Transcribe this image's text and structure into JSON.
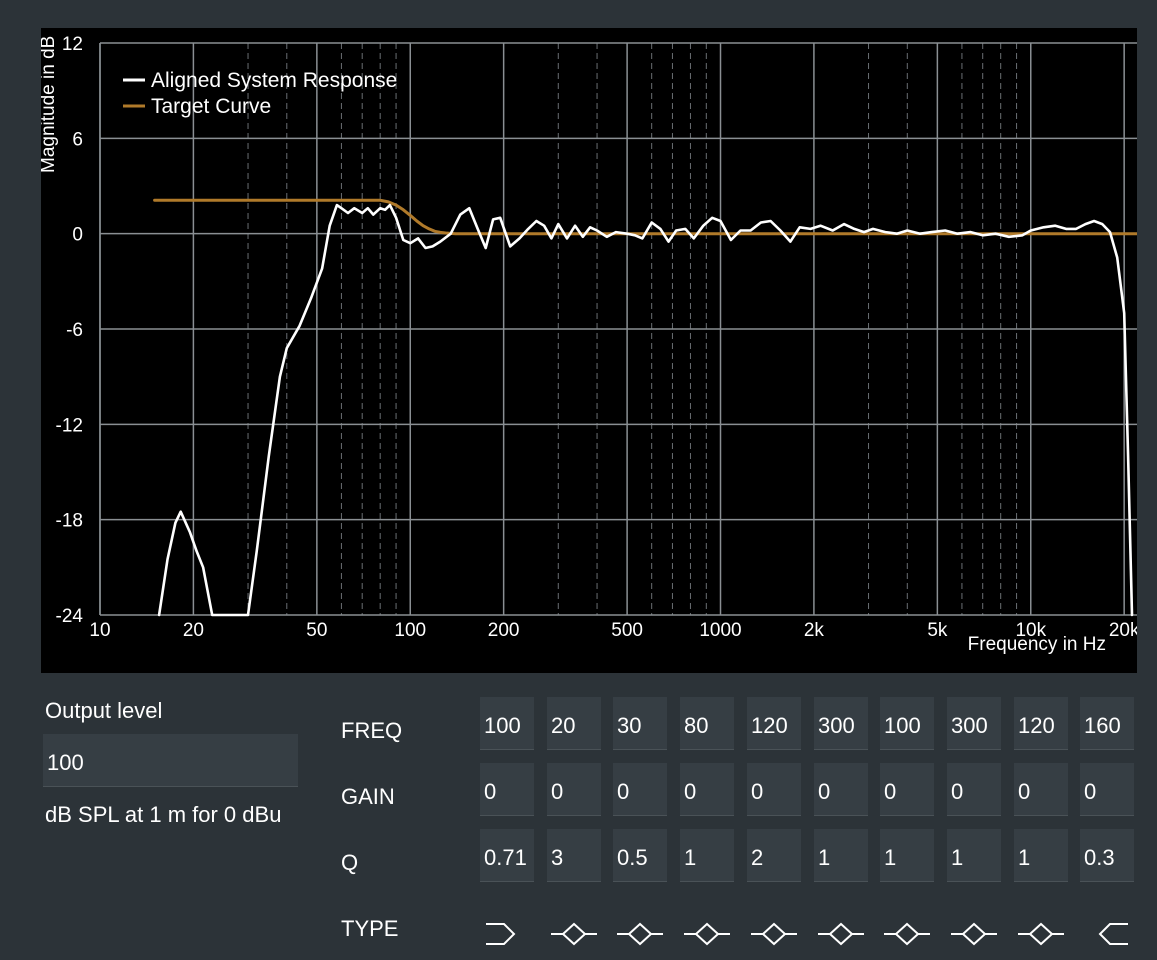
{
  "chart_data": {
    "type": "line",
    "x_scale": "log",
    "xlabel": "Frequency in Hz",
    "ylabel": "Magnitude in dB",
    "xlim": [
      10,
      22000
    ],
    "ylim": [
      -24,
      12
    ],
    "x_ticks": [
      10,
      20,
      50,
      100,
      200,
      500,
      1000,
      2000,
      5000,
      10000,
      20000
    ],
    "x_tick_labels": [
      "10",
      "20",
      "50",
      "100",
      "200",
      "500",
      "1000",
      "2k",
      "5k",
      "10k",
      "20k"
    ],
    "y_ticks": [
      12,
      6,
      0,
      -6,
      -12,
      -18,
      -24
    ],
    "y_tick_labels": [
      "12",
      "6",
      "0",
      "-6",
      "-12",
      "-18",
      "-24"
    ],
    "grid": true,
    "legend_position": "top-left",
    "series": [
      {
        "name": "Aligned System Response",
        "color": "#ffffff",
        "x": [
          15.5,
          16.5,
          17.5,
          18.2,
          19.5,
          20.5,
          21.5,
          23,
          30,
          32,
          35,
          38,
          40,
          44,
          48,
          52,
          55,
          58,
          60,
          63,
          66,
          70,
          73,
          76,
          80,
          83,
          86,
          90,
          95,
          100,
          106,
          112,
          118,
          125,
          135,
          145,
          155,
          165,
          175,
          185,
          195,
          210,
          225,
          240,
          255,
          270,
          285,
          300,
          320,
          340,
          360,
          380,
          400,
          430,
          460,
          500,
          530,
          560,
          600,
          640,
          680,
          720,
          770,
          820,
          880,
          940,
          1000,
          1080,
          1160,
          1250,
          1350,
          1450,
          1560,
          1680,
          1800,
          1950,
          2100,
          2300,
          2500,
          2700,
          2900,
          3100,
          3400,
          3700,
          4000,
          4400,
          4800,
          5300,
          5800,
          6400,
          7000,
          7700,
          8500,
          9400,
          10000,
          11000,
          12000,
          13000,
          14000,
          15000,
          16000,
          17000,
          18000,
          19000,
          20000,
          20600,
          21200
        ],
        "y": [
          -24,
          -20.5,
          -18.2,
          -17.5,
          -18.8,
          -20.0,
          -21.0,
          -24,
          -24,
          -20,
          -14,
          -9,
          -7.2,
          -5.8,
          -4.0,
          -2.2,
          0.5,
          1.8,
          1.6,
          1.3,
          1.6,
          1.3,
          1.6,
          1.2,
          1.6,
          1.5,
          1.8,
          1.0,
          -0.4,
          -0.6,
          -0.3,
          -0.9,
          -0.8,
          -0.5,
          0.0,
          1.2,
          1.6,
          0.3,
          -0.9,
          0.9,
          1.0,
          -0.8,
          -0.3,
          0.3,
          0.8,
          0.5,
          -0.3,
          0.6,
          -0.3,
          0.5,
          -0.2,
          0.4,
          0.2,
          -0.2,
          0.1,
          0.0,
          -0.1,
          -0.3,
          0.7,
          0.3,
          -0.5,
          0.2,
          0.3,
          -0.3,
          0.5,
          1.0,
          0.8,
          -0.4,
          0.2,
          0.2,
          0.7,
          0.8,
          0.2,
          -0.5,
          0.4,
          0.3,
          0.5,
          0.2,
          0.6,
          0.3,
          0.1,
          0.3,
          0.1,
          0.0,
          0.2,
          0.0,
          0.1,
          0.2,
          0.0,
          0.1,
          -0.1,
          0.0,
          -0.2,
          -0.1,
          0.2,
          0.4,
          0.5,
          0.3,
          0.3,
          0.6,
          0.8,
          0.6,
          0.1,
          -1.5,
          -5.0,
          -14.0,
          -24.0
        ]
      },
      {
        "name": "Target Curve",
        "color": "#b07a2a",
        "x": [
          15,
          20,
          30,
          50,
          70,
          80,
          85,
          90,
          95,
          100,
          105,
          110,
          115,
          120,
          125,
          130,
          140,
          150,
          200,
          500,
          1000,
          5000,
          10000,
          22000
        ],
        "y": [
          2.1,
          2.1,
          2.1,
          2.1,
          2.1,
          2.1,
          2.0,
          1.8,
          1.5,
          1.15,
          0.8,
          0.5,
          0.3,
          0.15,
          0.08,
          0.04,
          0.0,
          0.0,
          0.0,
          0.0,
          0.0,
          0.0,
          0.0,
          0.0
        ]
      }
    ]
  },
  "output": {
    "label": "Output level",
    "value": "100",
    "unit": "dB SPL at 1 m for 0 dBu"
  },
  "eq": {
    "row_labels": {
      "freq": "FREQ",
      "gain": "GAIN",
      "q": "Q",
      "type": "TYPE"
    },
    "bands": [
      {
        "freq": "100",
        "gain": "0",
        "q": "0.71",
        "type": "high-pass-icon"
      },
      {
        "freq": "20",
        "gain": "0",
        "q": "3",
        "type": "bell-icon"
      },
      {
        "freq": "30",
        "gain": "0",
        "q": "0.5",
        "type": "bell-icon"
      },
      {
        "freq": "80",
        "gain": "0",
        "q": "1",
        "type": "bell-icon"
      },
      {
        "freq": "120",
        "gain": "0",
        "q": "2",
        "type": "bell-icon"
      },
      {
        "freq": "300",
        "gain": "0",
        "q": "1",
        "type": "bell-icon"
      },
      {
        "freq": "100",
        "gain": "0",
        "q": "1",
        "type": "bell-icon"
      },
      {
        "freq": "300",
        "gain": "0",
        "q": "1",
        "type": "bell-icon"
      },
      {
        "freq": "120",
        "gain": "0",
        "q": "1",
        "type": "bell-icon"
      },
      {
        "freq": "160",
        "gain": "0",
        "q": "0.3",
        "type": "low-pass-icon"
      }
    ]
  },
  "colors": {
    "background": "#2c3338",
    "chart_background": "#000000",
    "field_background": "#363e44",
    "grid_major": "#8a8f93",
    "grid_minor": "#6a6f73",
    "response": "#ffffff",
    "target": "#b07a2a"
  }
}
